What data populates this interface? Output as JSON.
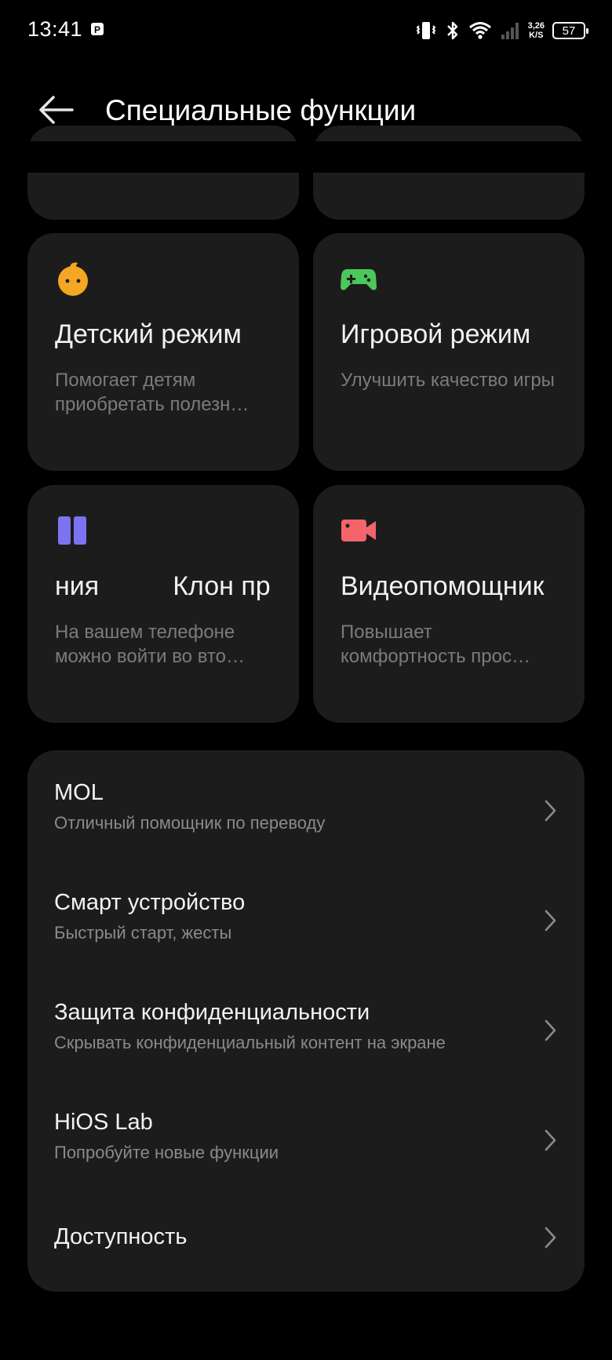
{
  "status_bar": {
    "time": "13:41",
    "speed_value": "3,26",
    "speed_unit": "K/S",
    "battery": "57"
  },
  "header": {
    "title": "Специальные функции"
  },
  "cards": [
    {
      "title": "Детский режим",
      "desc": "Помогает детям приобретать полезн…",
      "icon": "child-face-icon",
      "color": "#F5A623"
    },
    {
      "title": "Игровой режим",
      "desc": "Улучшить качество игры",
      "icon": "gamepad-icon",
      "color": "#4CC75A"
    },
    {
      "title_part1": "ния",
      "title_part2": "Клон пр",
      "desc": "На вашем телефоне можно войти во вто…",
      "icon": "dual-app-icon",
      "color": "#7C73F0"
    },
    {
      "title": "Видеопомощник",
      "desc": "Повышает комфортность прос…",
      "icon": "video-camera-icon",
      "color": "#F4646B"
    }
  ],
  "list": [
    {
      "title": "MOL",
      "subtitle": "Отличный помощник по переводу"
    },
    {
      "title": "Смарт устройство",
      "subtitle": "Быстрый старт, жесты"
    },
    {
      "title": "Защита конфиденциальности",
      "subtitle": "Скрывать конфиденциальный контент на экране"
    },
    {
      "title": "HiOS Lab",
      "subtitle": "Попробуйте новые функции"
    },
    {
      "title": "Доступность",
      "subtitle": ""
    }
  ]
}
